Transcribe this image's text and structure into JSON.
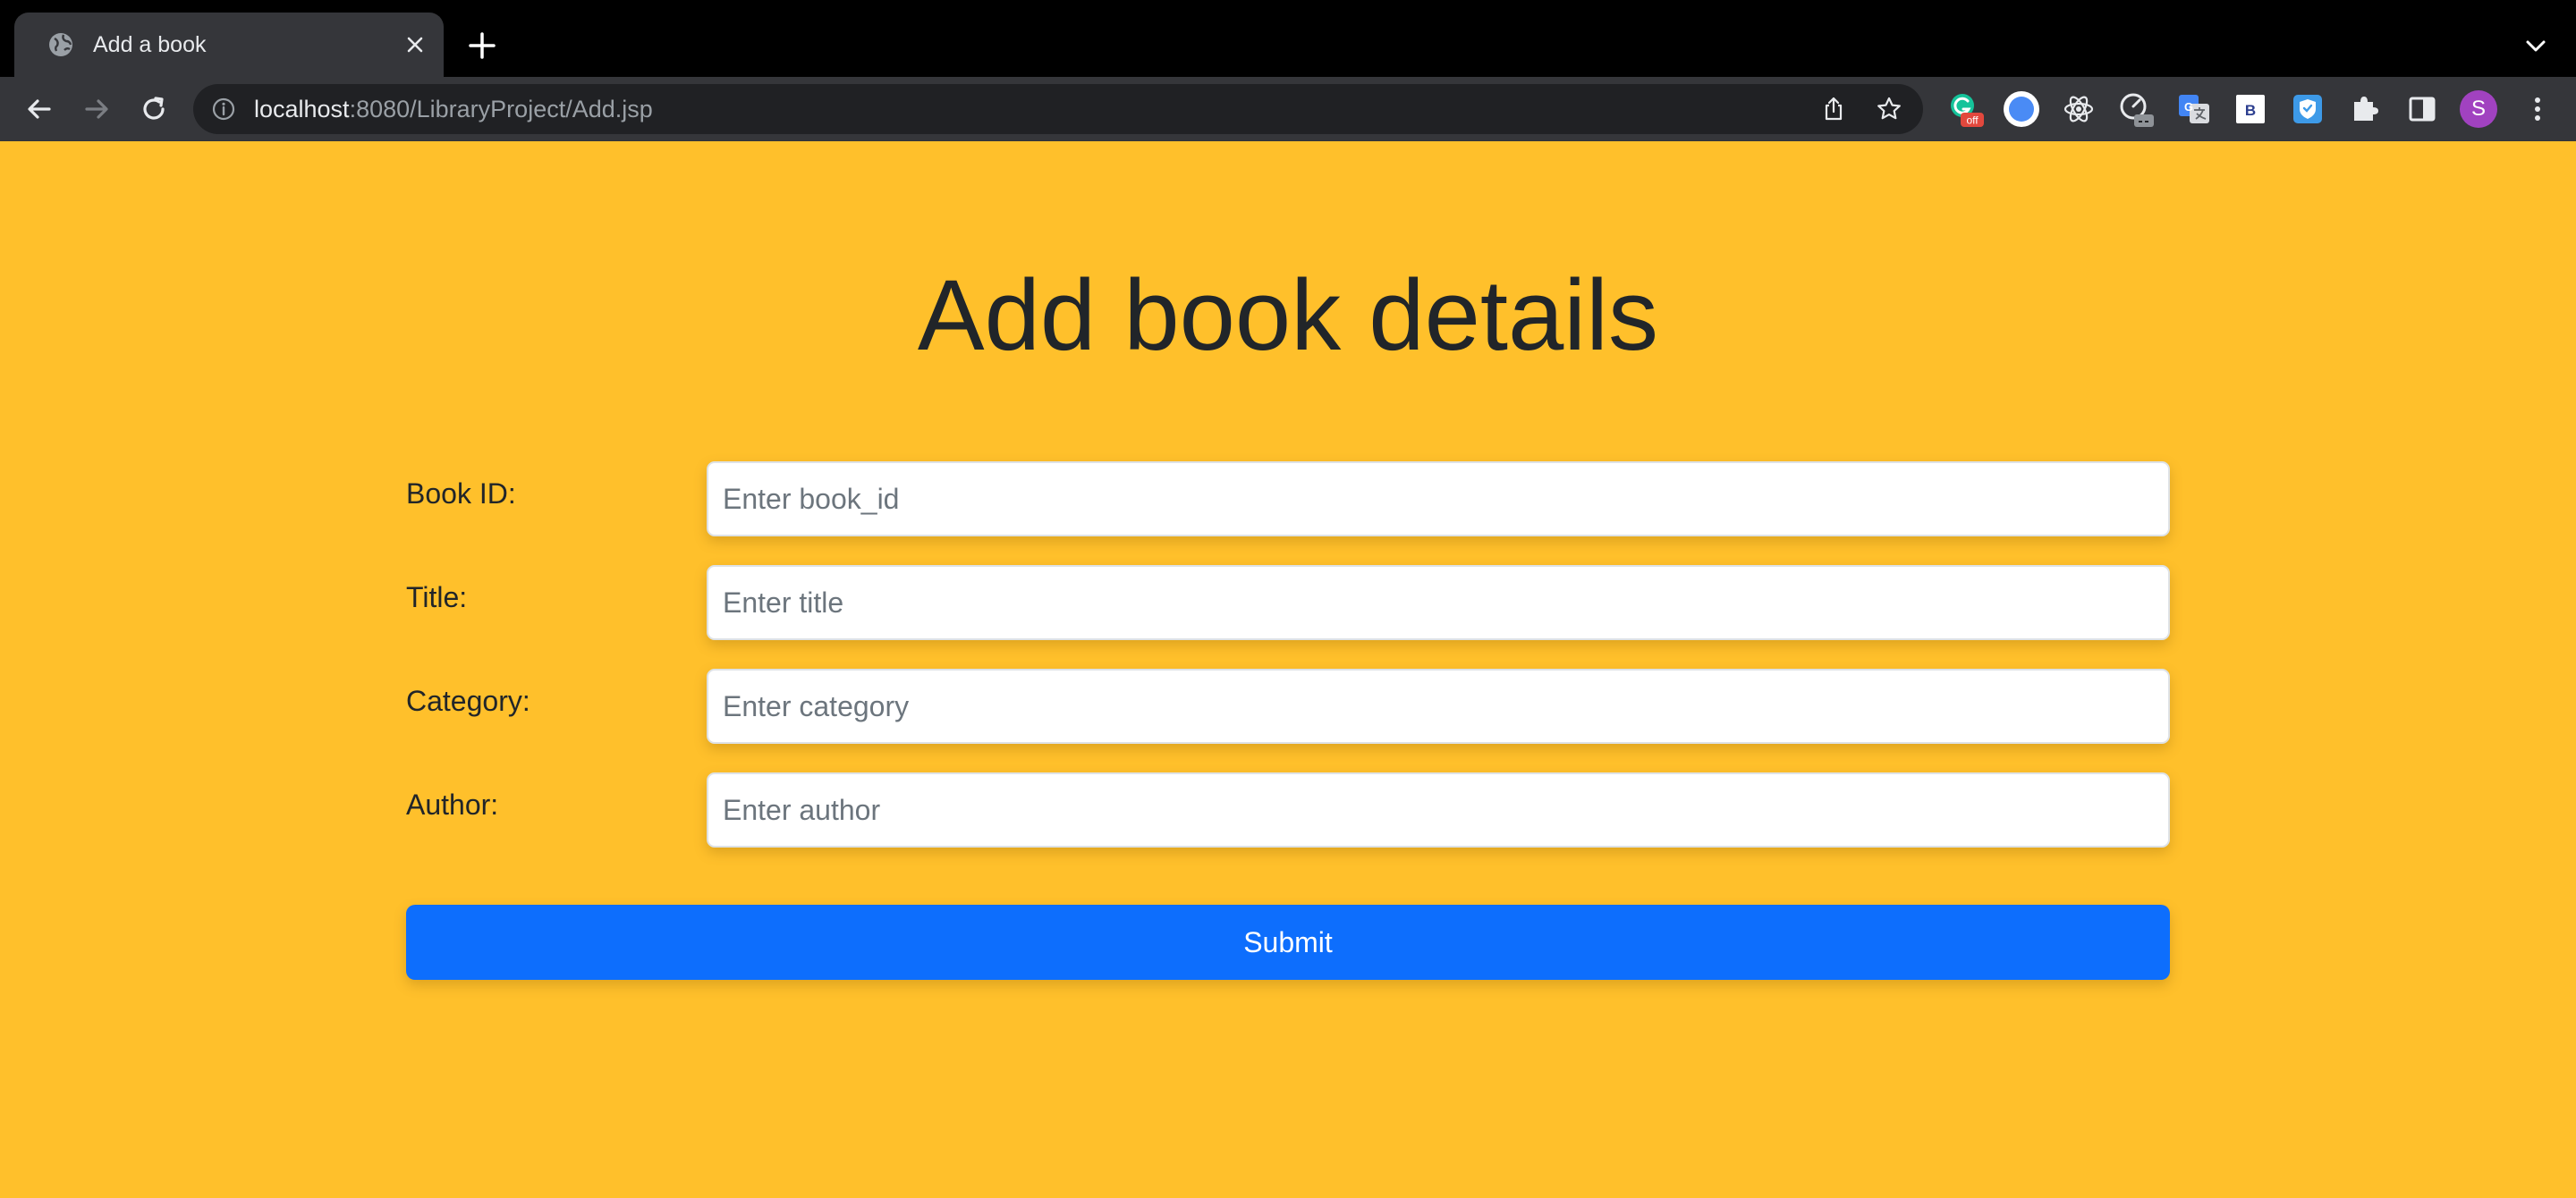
{
  "browser": {
    "tab_title": "Add a book",
    "url_host": "localhost",
    "url_path": ":8080/LibraryProject/Add.jsp",
    "grammarly_badge": "off",
    "avatar_letter": "S",
    "extension_b_label": "B"
  },
  "page": {
    "title": "Add book details",
    "fields": [
      {
        "label": "Book ID:",
        "placeholder": "Enter book_id"
      },
      {
        "label": "Title:",
        "placeholder": "Enter title"
      },
      {
        "label": "Category:",
        "placeholder": "Enter category"
      },
      {
        "label": "Author:",
        "placeholder": "Enter author"
      }
    ],
    "submit_label": "Submit"
  },
  "colors": {
    "page_background": "#ffc02b",
    "submit_button": "#0d6efd",
    "chrome_toolbar": "#35363a",
    "tabstrip": "#000000"
  }
}
